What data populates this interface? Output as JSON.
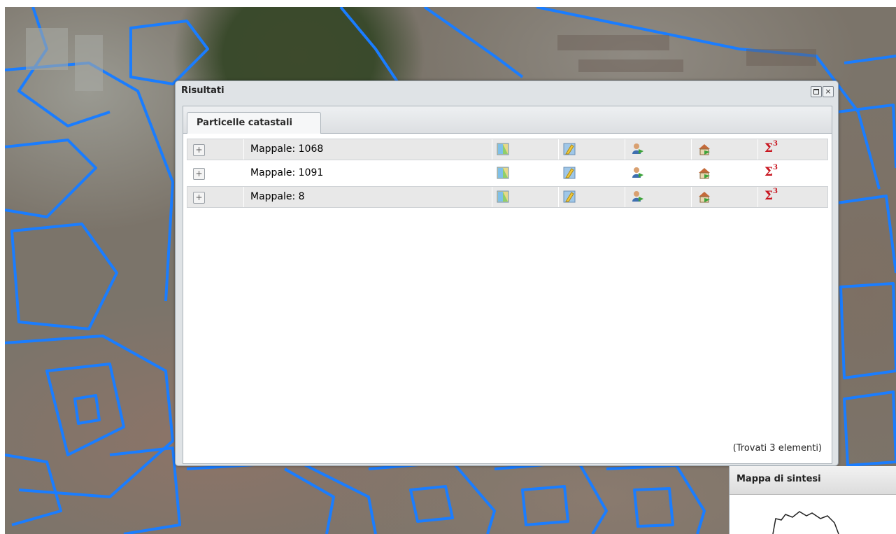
{
  "window": {
    "title": "Risultati",
    "tools": {
      "maximize": "maximize-icon",
      "close": "×"
    }
  },
  "tabs": [
    {
      "label": "Particelle catastali",
      "active": true
    }
  ],
  "results": {
    "rows": [
      {
        "expander": "+",
        "label": "Mappale: 1068"
      },
      {
        "expander": "+",
        "label": "Mappale: 1091"
      },
      {
        "expander": "+",
        "label": "Mappale: 8"
      }
    ],
    "row_actions": [
      "map-sheet-icon",
      "highlight-map-icon",
      "owner-person-icon",
      "building-house-icon",
      "sum-sigma-icon"
    ],
    "sigma_symbol": "Σ",
    "sigma_exponent": "3",
    "count_text": "(Trovati 3 elementi)"
  },
  "overview": {
    "title": "Mappa di sintesi"
  },
  "colors": {
    "parcel_outline": "#1a7dff",
    "sigma": "#c8141e",
    "row_shade": "#e8e8e8"
  }
}
